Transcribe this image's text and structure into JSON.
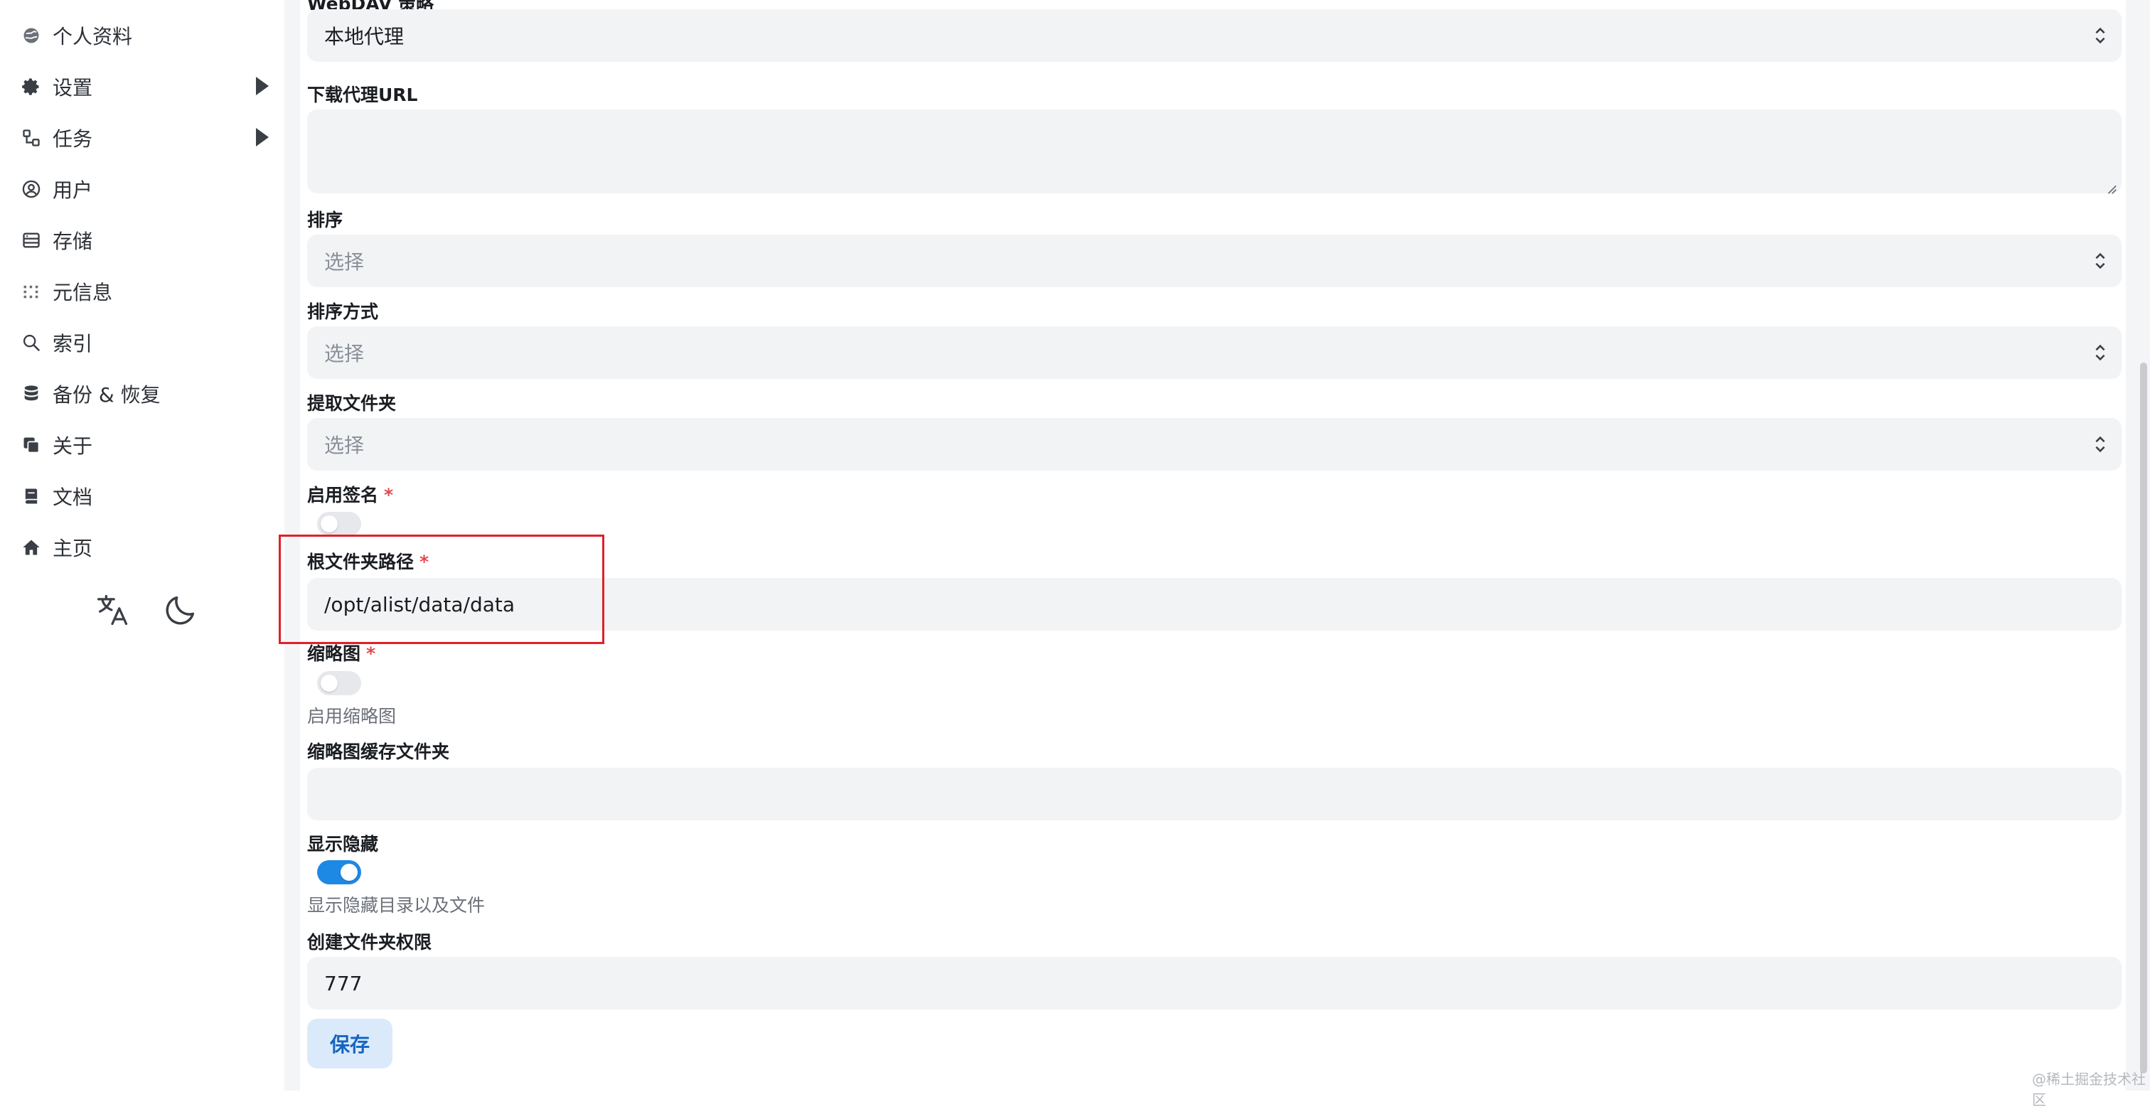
{
  "sidebar": {
    "items": [
      {
        "label": "个人资料",
        "icon": "profile-icon",
        "arrow": false
      },
      {
        "label": "设置",
        "icon": "gear-icon",
        "arrow": true
      },
      {
        "label": "任务",
        "icon": "tasks-icon",
        "arrow": true
      },
      {
        "label": "用户",
        "icon": "user-icon",
        "arrow": false
      },
      {
        "label": "存储",
        "icon": "storage-icon",
        "arrow": false
      },
      {
        "label": "元信息",
        "icon": "meta-icon",
        "arrow": false
      },
      {
        "label": "索引",
        "icon": "search-icon",
        "arrow": false
      },
      {
        "label": "备份 & 恢复",
        "icon": "database-icon",
        "arrow": false
      },
      {
        "label": "关于",
        "icon": "about-icon",
        "arrow": false
      },
      {
        "label": "文档",
        "icon": "docs-icon",
        "arrow": false
      },
      {
        "label": "主页",
        "icon": "home-icon",
        "arrow": false
      }
    ],
    "tools": {
      "language": "translate-icon",
      "theme": "moon-icon"
    }
  },
  "form": {
    "webdav_policy": {
      "label": "WebDAV 策略",
      "value": "本地代理"
    },
    "download_proxy_url": {
      "label": "下载代理URL",
      "value": ""
    },
    "order_by": {
      "label": "排序",
      "placeholder": "选择"
    },
    "order_direction": {
      "label": "排序方式",
      "placeholder": "选择"
    },
    "extract_folder": {
      "label": "提取文件夹",
      "placeholder": "选择"
    },
    "enable_sign": {
      "label": "启用签名",
      "required": "*",
      "enabled": false
    },
    "root_folder_path": {
      "label": "根文件夹路径",
      "required": "*",
      "value": "/opt/alist/data/data"
    },
    "thumbnail": {
      "label": "缩略图",
      "required": "*",
      "enabled": false,
      "help": "启用缩略图"
    },
    "thumbnail_cache_folder": {
      "label": "缩略图缓存文件夹",
      "value": ""
    },
    "show_hidden": {
      "label": "显示隐藏",
      "enabled": true,
      "help": "显示隐藏目录以及文件"
    },
    "mkdir_perm": {
      "label": "创建文件夹权限",
      "value": "777"
    },
    "save_label": "保存"
  },
  "watermark": "@稀土掘金技术社区",
  "colors": {
    "accent": "#1e88e5",
    "highlight": "#e0202a",
    "field_bg": "#f2f3f5"
  }
}
